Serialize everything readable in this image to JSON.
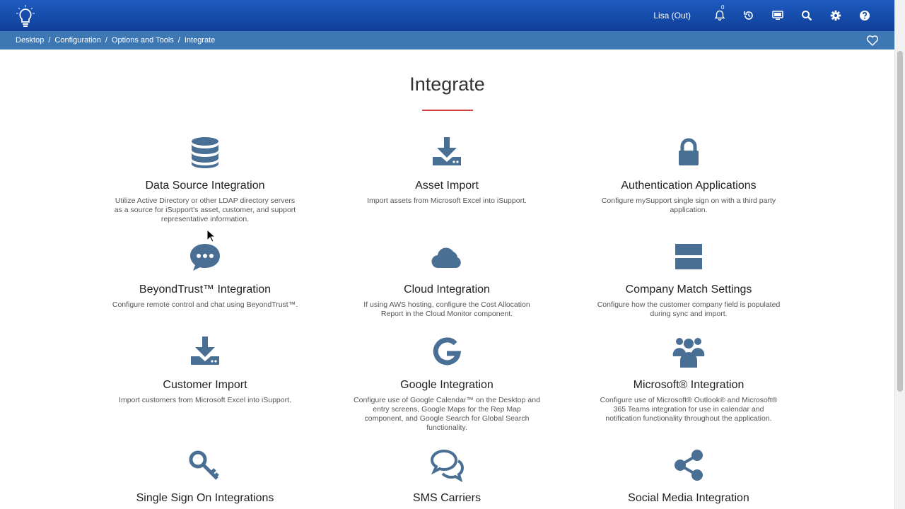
{
  "header": {
    "user_label": "Lisa (Out)",
    "notification_count": "0",
    "icons": [
      "bell-icon",
      "history-icon",
      "monitor-icon",
      "search-icon",
      "gear-icon",
      "help-icon"
    ],
    "brand_color": "#1e5bc0"
  },
  "breadcrumb": {
    "items": [
      "Desktop",
      "Configuration",
      "Options and Tools",
      "Integrate"
    ],
    "separator": "/"
  },
  "page": {
    "title": "Integrate",
    "accent_color": "#d04040"
  },
  "cards": [
    {
      "icon": "database-icon",
      "title": "Data Source Integration",
      "desc": "Utilize Active Directory or other LDAP directory servers as a source for iSupport's asset, customer, and support representative information."
    },
    {
      "icon": "download-icon",
      "title": "Asset Import",
      "desc": "Import assets from Microsoft Excel into iSupport."
    },
    {
      "icon": "lock-icon",
      "title": "Authentication Applications",
      "desc": "Configure mySupport single sign on with a third party application."
    },
    {
      "icon": "chat-bubble-icon",
      "title": "BeyondTrust™ Integration",
      "desc": "Configure remote control and chat using BeyondTrust™."
    },
    {
      "icon": "cloud-icon",
      "title": "Cloud Integration",
      "desc": "If using AWS hosting, configure the Cost Allocation Report in the Cloud Monitor component."
    },
    {
      "icon": "server-icon",
      "title": "Company Match Settings",
      "desc": "Configure how the customer company field is populated during sync and import."
    },
    {
      "icon": "download-icon",
      "title": "Customer Import",
      "desc": "Import customers from Microsoft Excel into iSupport."
    },
    {
      "icon": "google-icon",
      "title": "Google Integration",
      "desc": "Configure use of Google Calendar™ on the Desktop and entry screens, Google Maps for the Rep Map component, and Google Search for Global Search functionality."
    },
    {
      "icon": "users-icon",
      "title": "Microsoft® Integration",
      "desc": "Configure use of Microsoft® Outlook® and Microsoft® 365 Teams integration for use in calendar and notification functionality throughout the application."
    },
    {
      "icon": "key-icon",
      "title": "Single Sign On Integrations",
      "desc": ""
    },
    {
      "icon": "comments-icon",
      "title": "SMS Carriers",
      "desc": ""
    },
    {
      "icon": "share-icon",
      "title": "Social Media Integration",
      "desc": ""
    }
  ],
  "icon_color": "#4a6f94"
}
